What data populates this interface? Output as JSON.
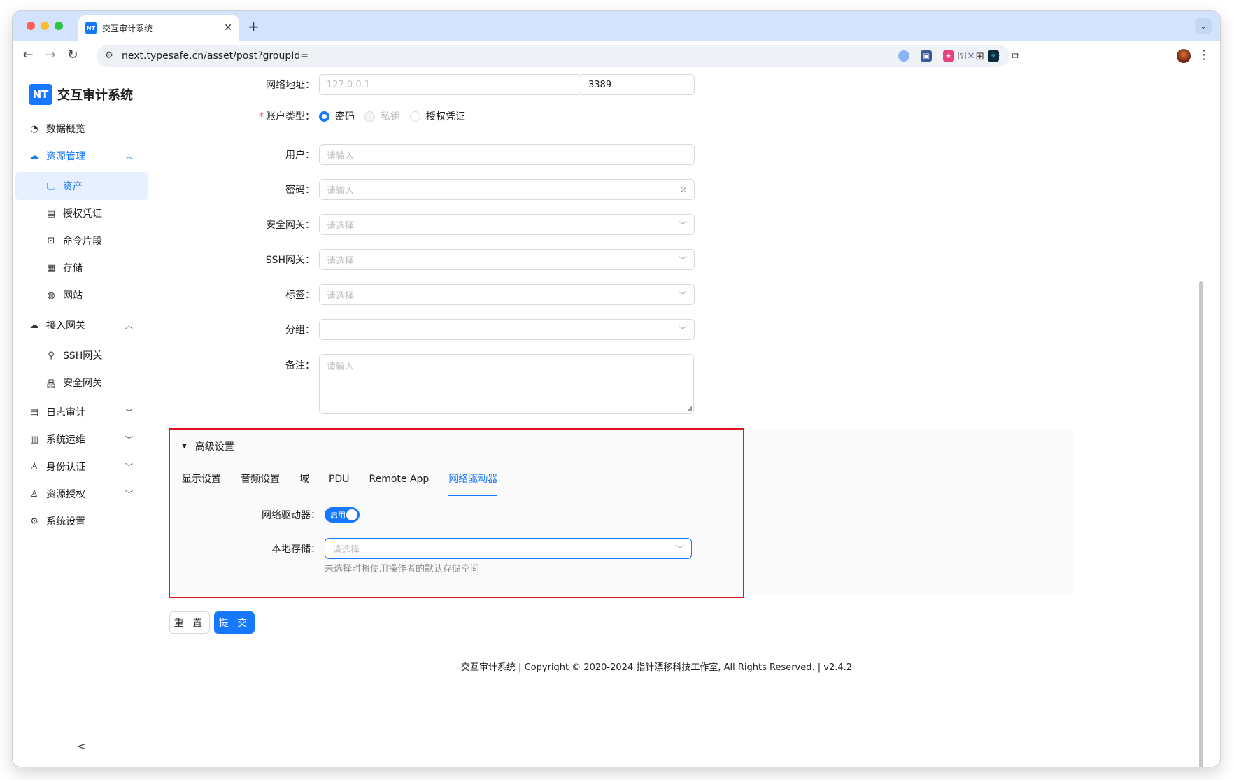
{
  "browser": {
    "tab_title": "交互审计系统",
    "tab_favicon": "NT",
    "new_tab": "+",
    "url": "next.typesafe.cn/asset/post?groupId="
  },
  "sidebar": {
    "brand_logo": "NT",
    "brand_name": "交互审计系统",
    "items": [
      {
        "label": "数据概览",
        "icon": "dashboard-icon"
      },
      {
        "label": "资源管理",
        "icon": "cloud-icon",
        "expanded": true
      },
      {
        "label": "资产",
        "icon": "monitor-icon",
        "selected": true
      },
      {
        "label": "授权凭证",
        "icon": "id-card-icon"
      },
      {
        "label": "命令片段",
        "icon": "terminal-icon"
      },
      {
        "label": "存储",
        "icon": "storage-icon"
      },
      {
        "label": "网站",
        "icon": "globe-icon"
      },
      {
        "label": "接入网关",
        "icon": "gateway-icon",
        "expanded": true
      },
      {
        "label": "SSH网关",
        "icon": "ssh-icon"
      },
      {
        "label": "安全网关",
        "icon": "cluster-icon"
      },
      {
        "label": "日志审计",
        "icon": "audit-icon"
      },
      {
        "label": "系统运维",
        "icon": "ops-icon"
      },
      {
        "label": "身份认证",
        "icon": "user-icon"
      },
      {
        "label": "资源授权",
        "icon": "user-icon"
      },
      {
        "label": "系统设置",
        "icon": "gear-icon"
      }
    ],
    "collapse": "<"
  },
  "form": {
    "address_label": "网络地址",
    "address_placeholder": "127.0.0.1",
    "port_value": "3389",
    "account_type_label": "账户类型",
    "account_types": [
      {
        "label": "密码",
        "checked": true,
        "disabled": false
      },
      {
        "label": "私钥",
        "checked": false,
        "disabled": true
      },
      {
        "label": "授权凭证",
        "checked": false,
        "disabled": false
      }
    ],
    "user_label": "用户",
    "user_placeholder": "请输入",
    "password_label": "密码",
    "password_placeholder": "请输入",
    "security_gateway_label": "安全网关",
    "security_gateway_placeholder": "请选择",
    "ssh_gateway_label": "SSH网关",
    "ssh_gateway_placeholder": "请选择",
    "tags_label": "标签",
    "tags_placeholder": "请选择",
    "group_label": "分组",
    "group_value": "",
    "remark_label": "备注",
    "remark_placeholder": "请输入",
    "colon": "："
  },
  "advanced": {
    "title": "高级设置",
    "tabs": [
      "显示设置",
      "音频设置",
      "域",
      "PDU",
      "Remote App",
      "网络驱动器"
    ],
    "active_tab": "网络驱动器",
    "drive_label": "网络驱动器",
    "drive_switch": "启用",
    "drive_enabled": true,
    "storage_label": "本地存储",
    "storage_placeholder": "请选择",
    "storage_help": "未选择时将使用操作者的默认存储空间"
  },
  "actions": {
    "reset": "重 置",
    "submit": "提 交"
  },
  "footer": "交互审计系统 | Copyright © 2020-2024 指针漂移科技工作室, All Rights Reserved. | v2.4.2",
  "colors": {
    "primary": "#1677ff",
    "highlight_box": "#e0141e"
  }
}
